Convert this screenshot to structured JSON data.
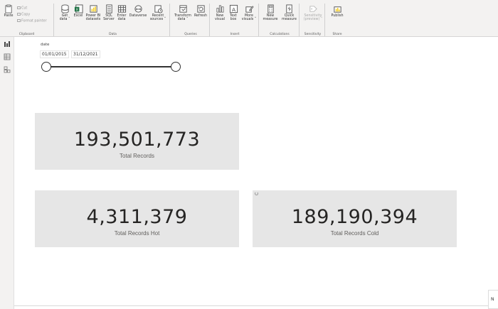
{
  "ribbon": {
    "clipboard": {
      "group_label": "Clipboard",
      "paste": "Paste",
      "cut": "Cut",
      "copy": "Copy",
      "format_painter": "Format painter"
    },
    "data": {
      "group_label": "Data",
      "get_data": [
        "Get",
        "data ˅"
      ],
      "excel": [
        "Excel"
      ],
      "power_bi_datasets": [
        "Power BI",
        "datasets"
      ],
      "sql_server": [
        "SQL",
        "Server"
      ],
      "enter_data": [
        "Enter",
        "data"
      ],
      "dataverse": [
        "Dataverse"
      ],
      "recent_sources": [
        "Recent",
        "sources ˅"
      ]
    },
    "queries": {
      "group_label": "Queries",
      "transform_data": [
        "Transform",
        "data ˅"
      ],
      "refresh": [
        "Refresh"
      ]
    },
    "insert": {
      "group_label": "Insert",
      "new_visual": [
        "New",
        "visual"
      ],
      "text_box": [
        "Text",
        "box"
      ],
      "more_visuals": [
        "More",
        "visuals ˅"
      ]
    },
    "calculations": {
      "group_label": "Calculations",
      "new_measure": [
        "New",
        "measure"
      ],
      "quick_measure": [
        "Quick",
        "measure"
      ]
    },
    "sensitivity": {
      "group_label": "Sensitivity",
      "sensitivity": [
        "Sensitivity",
        "(preview) ˅"
      ]
    },
    "share": {
      "group_label": "Share",
      "publish": [
        "Publish"
      ]
    }
  },
  "slicer": {
    "title": "date",
    "start_date": "01/01/2015",
    "end_date": "31/12/2021",
    "range_fraction": [
      0,
      1
    ]
  },
  "cards": [
    {
      "value": "193,501,773",
      "label": "Total Records"
    },
    {
      "value": "4,311,379",
      "label": "Total Records Hot"
    },
    {
      "value": "189,190,394",
      "label": "Total Records Cold"
    }
  ],
  "corner_tab": {
    "label": "N"
  },
  "colors": {
    "card_bg": "#e6e6e6",
    "ribbon_bg": "#f3f2f1",
    "excel_green": "#217346",
    "powerbi_yellow": "#f2c811"
  }
}
